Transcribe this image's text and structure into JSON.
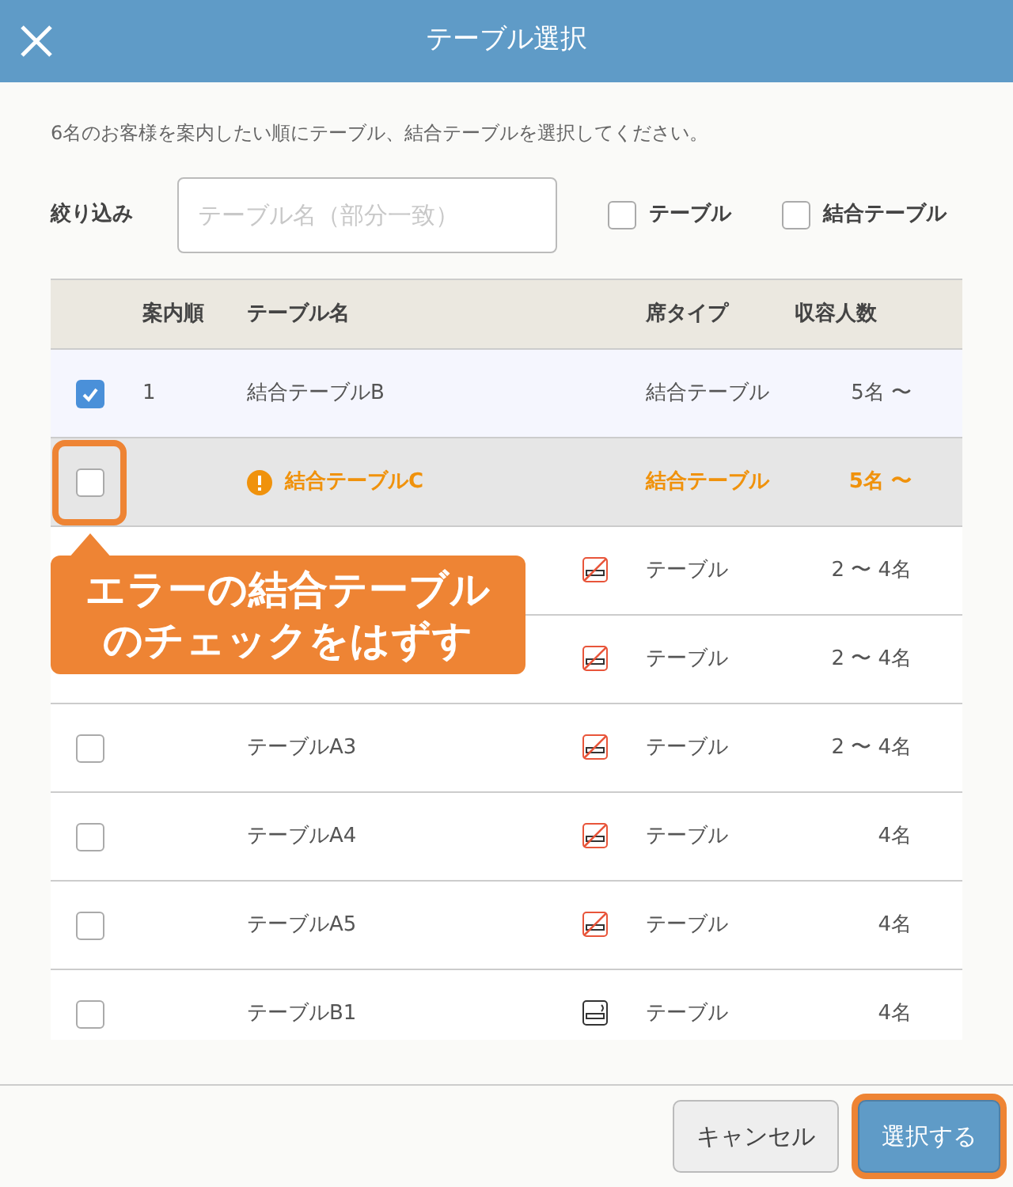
{
  "window": {
    "title": "テーブル選択"
  },
  "instruction": "6名のお客様を案内したい順にテーブル、結合テーブルを選択してください。",
  "filter": {
    "label": "絞り込み",
    "placeholder": "テーブル名（部分一致）",
    "options": [
      {
        "label": "テーブル",
        "checked": false
      },
      {
        "label": "結合テーブル",
        "checked": false
      }
    ]
  },
  "table": {
    "columns": [
      "案内順",
      "テーブル名",
      "席タイプ",
      "収容人数"
    ],
    "rows": [
      {
        "checked": true,
        "error": false,
        "order": "1",
        "name": "結合テーブルB",
        "seat_type": "結合テーブル",
        "capacity": "5名 〜"
      },
      {
        "checked": false,
        "error": true,
        "name": "結合テーブルC",
        "seat_type": "結合テーブル",
        "capacity": "5名 〜"
      },
      {
        "smoking": false,
        "seat_type": "テーブル",
        "capacity": "2 〜 4名"
      },
      {
        "smoking": false,
        "seat_type": "テーブル",
        "capacity": "2 〜 4名"
      },
      {
        "checked": false,
        "name": "テーブルA3",
        "smoking": false,
        "seat_type": "テーブル",
        "capacity": "2 〜 4名"
      },
      {
        "checked": false,
        "name": "テーブルA4",
        "smoking": false,
        "seat_type": "テーブル",
        "capacity": "4名"
      },
      {
        "checked": false,
        "name": "テーブルA5",
        "smoking": false,
        "seat_type": "テーブル",
        "capacity": "4名"
      },
      {
        "checked": false,
        "name": "テーブルB1",
        "smoking": true,
        "seat_type": "テーブル",
        "capacity": "4名"
      }
    ]
  },
  "callout": {
    "text": "エラーの結合テーブルのチェックをはずす"
  },
  "buttons": [
    {
      "label": "キャンセル",
      "kind": "secondary",
      "highlighted": false
    },
    {
      "label": "選択する",
      "kind": "primary",
      "highlighted": true
    }
  ]
}
